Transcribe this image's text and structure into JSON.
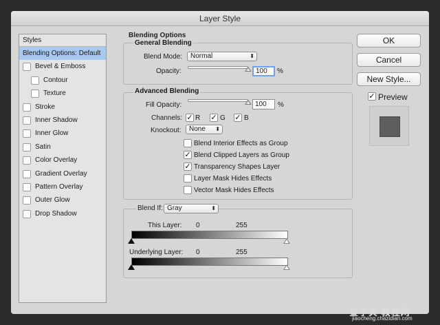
{
  "window": {
    "title": "Layer Style"
  },
  "styles": {
    "header": "Styles",
    "items": [
      {
        "label": "Blending Options: Default",
        "selected": true,
        "checkbox": false,
        "indent": 0
      },
      {
        "label": "Bevel & Emboss",
        "checkbox": true,
        "indent": 0
      },
      {
        "label": "Contour",
        "checkbox": true,
        "indent": 1
      },
      {
        "label": "Texture",
        "checkbox": true,
        "indent": 1
      },
      {
        "label": "Stroke",
        "checkbox": true,
        "indent": 0
      },
      {
        "label": "Inner Shadow",
        "checkbox": true,
        "indent": 0
      },
      {
        "label": "Inner Glow",
        "checkbox": true,
        "indent": 0
      },
      {
        "label": "Satin",
        "checkbox": true,
        "indent": 0
      },
      {
        "label": "Color Overlay",
        "checkbox": true,
        "indent": 0
      },
      {
        "label": "Gradient Overlay",
        "checkbox": true,
        "indent": 0
      },
      {
        "label": "Pattern Overlay",
        "checkbox": true,
        "indent": 0
      },
      {
        "label": "Outer Glow",
        "checkbox": true,
        "indent": 0
      },
      {
        "label": "Drop Shadow",
        "checkbox": true,
        "indent": 0
      }
    ]
  },
  "blending": {
    "title": "Blending Options",
    "general": {
      "title": "General Blending",
      "blend_mode_label": "Blend Mode:",
      "blend_mode_value": "Normal",
      "opacity_label": "Opacity:",
      "opacity_value": "100",
      "opacity_unit": "%",
      "opacity_fraction": 1.0
    },
    "advanced": {
      "title": "Advanced Blending",
      "fill_opacity_label": "Fill Opacity:",
      "fill_opacity_value": "100",
      "fill_opacity_unit": "%",
      "channels_label": "Channels:",
      "channels": [
        {
          "label": "R",
          "checked": true
        },
        {
          "label": "G",
          "checked": true
        },
        {
          "label": "B",
          "checked": true
        }
      ],
      "knockout_label": "Knockout:",
      "knockout_value": "None",
      "options": [
        {
          "label": "Blend Interior Effects as Group",
          "checked": false
        },
        {
          "label": "Blend Clipped Layers as Group",
          "checked": true
        },
        {
          "label": "Transparency Shapes Layer",
          "checked": true
        },
        {
          "label": "Layer Mask Hides Effects",
          "checked": false
        },
        {
          "label": "Vector Mask Hides Effects",
          "checked": false
        }
      ]
    },
    "blend_if": {
      "label": "Blend If:",
      "value": "Gray",
      "this_layer_label": "This Layer:",
      "this_layer_min": "0",
      "this_layer_max": "255",
      "underlying_label": "Underlying Layer:",
      "underlying_min": "0",
      "underlying_max": "255"
    }
  },
  "buttons": {
    "ok": "OK",
    "cancel": "Cancel",
    "new_style": "New Style...",
    "preview_label": "Preview",
    "preview_checked": true
  },
  "watermark": {
    "line1": "查字典 教程网",
    "line2": "jiaocheng.chazidian.com"
  },
  "colors": {
    "dialog_bg": "#d6d6d6",
    "selection": "#a9c8f0",
    "focus_ring": "#6fa2e6",
    "preview_swatch": "#5e5e5e"
  }
}
